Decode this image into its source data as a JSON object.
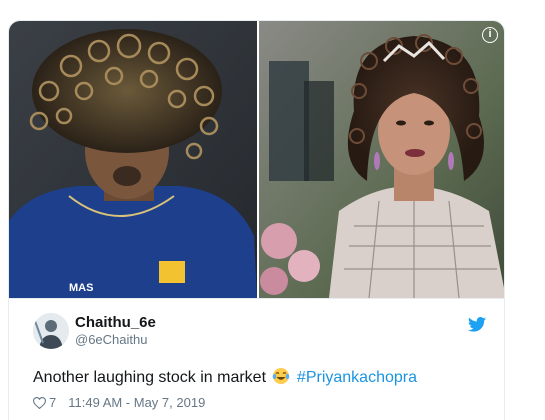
{
  "media": {
    "info_icon": "info-icon",
    "left_photo": "curly-haired-cricketer-photo",
    "right_photo": "curly-haired-woman-photo"
  },
  "tweet": {
    "display_name": "Chaithu_6e",
    "handle": "@6eChaithu",
    "text_before": "Another laughing stock in market",
    "emoji": "tears-of-joy-emoji",
    "hashtag": "#Priyankachopra",
    "likes": "7",
    "timestamp": "11:49 AM - May 7, 2019",
    "bird_icon": "twitter-bird-icon",
    "heart_icon": "heart-icon"
  },
  "colors": {
    "brand_blue": "#1da1f2",
    "hashtag_blue": "#1b95e0",
    "text_primary": "#14171a",
    "text_secondary": "#657786"
  }
}
